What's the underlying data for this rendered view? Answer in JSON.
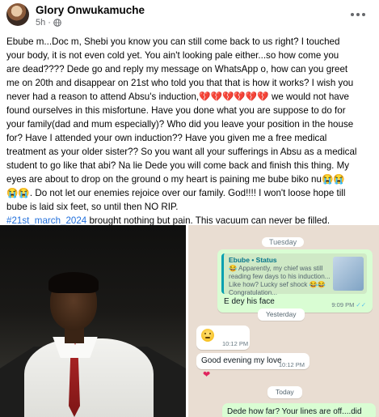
{
  "post": {
    "author": "Glory Onwukamuche",
    "time": "5h",
    "separator": "·",
    "privacy_icon": "globe-icon",
    "more_icon": "more-options-icon",
    "lines": [
      "Ebube m...Doc m, Shebi you know you can still come back to us right? I touched",
      "your body, it is not even cold yet. You ain't looking pale either...so how come you",
      "are dead???? Dede go and reply my message on WhatsApp o, how can you greet",
      "me on 20th and disappear on 21st who told you that that is how it works? I wish you",
      "never had a reason to attend Absu's induction,",
      "found ourselves in this misfortune. Have you done what you are suppose to do for",
      "your family(dad and mum especially)? Who did you leave your position in the house",
      "for? Have I attended your own induction?? Have you given me a free medical",
      "treatment as your older sister?? So you want all your sufferings in Absu as a medical",
      "student to go like that abi? Na lie Dede you will come back and finish this thing. My",
      "eyes are about to drop on the ground o my heart is paining me bube biko nu",
      "",
      ". Do not let our enemies rejoice over our family. God!!!! I won't loose hope till",
      "bube is laid six feet, so until then NO RIP."
    ],
    "hearts": "💔💔💔💔💔💔",
    "line5_tail": " we would not have",
    "crying_emojis_1": "😭😭",
    "crying_emojis_2": "😭😭",
    "hashtag": "#21st_march_2024",
    "last_line": " brought nothing but pain. This vacuum can never be filled."
  },
  "chat": {
    "top_chip": "Tuesday",
    "status_reply_title": "Ebube • Status",
    "status_reply_body": "😂 Apparently, my chief was still reading few days to his induction... Like how? Lucky sef shock 😂😂 Congratulation...",
    "msg1": "E dey his face",
    "msg1_time": "9:09 PM",
    "ticks": "✓✓",
    "chip_yesterday": "Yesterday",
    "msg2_time": "10:12 PM",
    "msg3": "Good evening my love",
    "msg3_time": "10:12 PM",
    "heart_reaction": "❤",
    "chip_today": "Today",
    "msg4": "Dede how far? Your lines are off....did"
  }
}
